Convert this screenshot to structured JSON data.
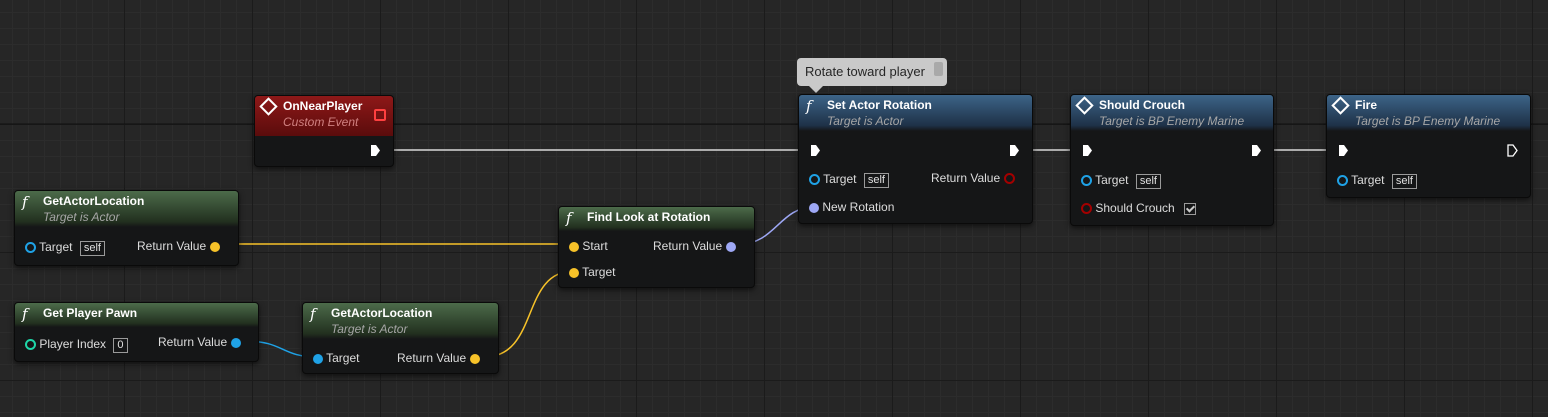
{
  "comment": {
    "text": "Rotate toward player"
  },
  "nodes": {
    "on_near_player": {
      "title": "OnNearPlayer",
      "subtitle": "Custom Event"
    },
    "get_actor_location_1": {
      "title": "GetActorLocation",
      "subtitle": "Target is Actor",
      "target_label": "Target",
      "target_default": "self",
      "return_label": "Return Value"
    },
    "get_player_pawn": {
      "title": "Get Player Pawn",
      "player_index_label": "Player Index",
      "player_index_value": "0",
      "return_label": "Return Value"
    },
    "get_actor_location_2": {
      "title": "GetActorLocation",
      "subtitle": "Target is Actor",
      "target_label": "Target",
      "return_label": "Return Value"
    },
    "find_look_at_rotation": {
      "title": "Find Look at Rotation",
      "start_label": "Start",
      "target_label": "Target",
      "return_label": "Return Value"
    },
    "set_actor_rotation": {
      "title": "Set Actor Rotation",
      "subtitle": "Target is Actor",
      "target_label": "Target",
      "target_default": "self",
      "return_label": "Return Value",
      "new_rotation_label": "New Rotation"
    },
    "should_crouch": {
      "title": "Should Crouch",
      "subtitle": "Target is BP Enemy Marine",
      "target_label": "Target",
      "target_default": "self",
      "should_crouch_label": "Should Crouch",
      "should_crouch_checked": true
    },
    "fire": {
      "title": "Fire",
      "subtitle": "Target is BP Enemy Marine",
      "target_label": "Target",
      "target_default": "self"
    }
  },
  "colors": {
    "exec": "#ffffff",
    "vector": "#f7c229",
    "rotator": "#9ea8f5",
    "object": "#1fa2e6",
    "bool": "#8c0000",
    "int": "#1fd6a8",
    "event_header": "#8e1818",
    "function_header": "#3d6488",
    "pure_header": "#4c6b4a"
  }
}
